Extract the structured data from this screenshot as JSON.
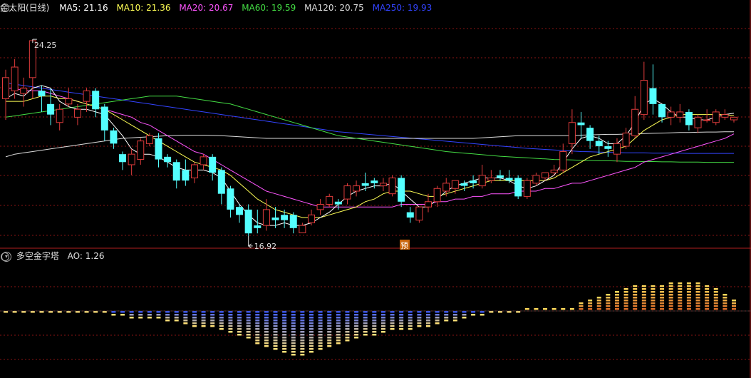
{
  "colors": {
    "background": "#000000",
    "grid": "#8a1515",
    "up_candle": "#e03c3c",
    "down_candle": "#54ffff",
    "ma5": "#ffffff",
    "ma10": "#ffff55",
    "ma20": "#ff55ff",
    "ma60": "#44dd44",
    "ma120": "#dddddd",
    "ma250": "#3344ff",
    "text": "#e0e0e0"
  },
  "main_header": {
    "collapse_icon": "circle-chevron-icon",
    "title": "金太阳(日线)",
    "ma5": "MA5: 21.16",
    "ma10": "MA10: 21.36",
    "ma20": "MA20: 20.67",
    "ma60": "MA60: 19.59",
    "ma120": "MA120: 20.75",
    "ma250": "MA250: 19.93"
  },
  "indicator_header": {
    "collapse_icon": "circle-chevron-icon",
    "title": "多空金字塔",
    "ao": "AO: 1.26"
  },
  "high_label": "24.25",
  "low_label": "16.92",
  "forecast_badge": "预",
  "chart_data": [
    {
      "type": "candlestick",
      "ylim": [
        16.5,
        25.2
      ],
      "candles": [
        [
          22.0,
          22.8,
          21.2,
          23.1
        ],
        [
          22.3,
          23.2,
          22.0,
          23.5
        ],
        [
          22.2,
          22.4,
          21.7,
          22.8
        ],
        [
          22.8,
          24.2,
          22.0,
          24.25
        ],
        [
          22.3,
          22.1,
          21.5,
          22.5
        ],
        [
          21.8,
          21.4,
          21.0,
          22.4
        ],
        [
          21.1,
          21.6,
          20.8,
          21.8
        ],
        [
          21.8,
          22.0,
          21.7,
          22.4
        ],
        [
          21.3,
          21.6,
          21.0,
          21.8
        ],
        [
          21.9,
          22.3,
          21.5,
          22.4
        ],
        [
          22.3,
          21.6,
          21.3,
          22.4
        ],
        [
          21.7,
          20.8,
          20.4,
          21.8
        ],
        [
          20.8,
          20.3,
          20.1,
          20.9
        ],
        [
          19.9,
          19.6,
          19.3,
          20.0
        ],
        [
          19.5,
          19.9,
          19.1,
          20.1
        ],
        [
          19.7,
          20.4,
          19.5,
          20.5
        ],
        [
          20.3,
          20.6,
          20.2,
          20.7
        ],
        [
          20.5,
          19.7,
          19.4,
          20.7
        ],
        [
          19.8,
          19.6,
          19.4,
          19.9
        ],
        [
          19.6,
          18.9,
          18.6,
          19.7
        ],
        [
          19.3,
          18.9,
          18.7,
          19.7
        ],
        [
          19.0,
          19.5,
          18.8,
          19.6
        ],
        [
          19.5,
          19.8,
          19.3,
          19.9
        ],
        [
          19.8,
          19.2,
          18.9,
          19.9
        ],
        [
          19.3,
          18.4,
          18.0,
          19.4
        ],
        [
          18.6,
          17.8,
          17.5,
          18.7
        ],
        [
          17.9,
          17.6,
          17.3,
          18.0
        ],
        [
          17.8,
          16.9,
          16.8,
          18.0
        ],
        [
          17.2,
          17.1,
          16.9,
          17.8
        ],
        [
          17.2,
          17.8,
          17.0,
          18.2
        ],
        [
          17.5,
          17.4,
          17.1,
          17.9
        ],
        [
          17.6,
          17.4,
          17.1,
          17.8
        ],
        [
          17.6,
          17.1,
          16.9,
          17.7
        ],
        [
          16.92,
          17.2,
          16.92,
          17.3
        ],
        [
          17.3,
          17.6,
          17.2,
          17.8
        ],
        [
          17.8,
          18.0,
          17.6,
          18.2
        ],
        [
          18.0,
          18.3,
          17.9,
          18.4
        ],
        [
          18.1,
          18.0,
          17.8,
          18.2
        ],
        [
          18.2,
          18.7,
          18.0,
          18.8
        ],
        [
          18.5,
          18.7,
          18.3,
          18.9
        ],
        [
          18.8,
          18.7,
          18.5,
          19.2
        ],
        [
          18.9,
          18.8,
          18.6,
          19.0
        ],
        [
          18.7,
          18.8,
          18.5,
          19.0
        ],
        [
          18.4,
          19.0,
          18.3,
          19.1
        ],
        [
          19.0,
          18.1,
          17.9,
          19.1
        ],
        [
          17.7,
          17.5,
          17.3,
          17.9
        ],
        [
          17.4,
          17.9,
          17.3,
          17.9
        ],
        [
          17.9,
          18.1,
          17.7,
          18.4
        ],
        [
          18.1,
          18.6,
          17.9,
          18.7
        ],
        [
          18.5,
          18.8,
          18.3,
          19.0
        ],
        [
          18.6,
          18.9,
          18.4,
          18.9
        ],
        [
          18.8,
          18.7,
          18.5,
          18.9
        ],
        [
          18.9,
          18.8,
          18.6,
          19.1
        ],
        [
          18.7,
          19.1,
          18.6,
          19.5
        ],
        [
          18.9,
          19.0,
          18.8,
          19.3
        ],
        [
          19.1,
          19.0,
          18.9,
          19.3
        ],
        [
          19.0,
          18.9,
          18.8,
          19.3
        ],
        [
          19.0,
          18.3,
          18.2,
          19.1
        ],
        [
          18.3,
          18.9,
          18.2,
          19.0
        ],
        [
          18.8,
          19.1,
          18.7,
          19.2
        ],
        [
          19.0,
          19.2,
          18.9,
          19.2
        ],
        [
          19.2,
          19.3,
          19.1,
          19.5
        ],
        [
          19.3,
          20.0,
          19.2,
          20.3
        ],
        [
          20.3,
          21.1,
          19.9,
          21.6
        ],
        [
          21.1,
          21.0,
          20.5,
          21.5
        ],
        [
          20.9,
          20.4,
          20.1,
          21.0
        ],
        [
          20.4,
          20.2,
          19.9,
          20.6
        ],
        [
          20.2,
          20.1,
          19.8,
          20.4
        ],
        [
          19.9,
          20.3,
          19.6,
          20.5
        ],
        [
          20.2,
          20.7,
          20.1,
          20.9
        ],
        [
          20.6,
          21.6,
          20.5,
          22.1
        ],
        [
          21.4,
          22.7,
          21.2,
          23.4
        ],
        [
          22.4,
          21.8,
          21.4,
          23.3
        ],
        [
          21.8,
          21.3,
          21.1,
          21.6
        ],
        [
          21.3,
          21.5,
          21.0,
          21.7
        ],
        [
          21.3,
          21.5,
          21.1,
          21.8
        ],
        [
          21.5,
          21.0,
          20.8,
          21.6
        ],
        [
          20.9,
          21.3,
          20.7,
          21.4
        ],
        [
          21.2,
          21.2,
          21.1,
          21.6
        ],
        [
          21.1,
          21.5,
          21.0,
          21.6
        ],
        [
          21.3,
          21.4,
          21.2,
          21.6
        ],
        [
          21.2,
          21.3,
          21.1,
          21.3
        ]
      ],
      "ma5": [
        22.0,
        22.2,
        22.1,
        22.4,
        22.5,
        22.4,
        21.9,
        21.7,
        21.6,
        21.6,
        21.5,
        21.4,
        21.0,
        20.6,
        20.1,
        19.9,
        19.9,
        19.8,
        19.6,
        19.4,
        19.3,
        19.3,
        19.3,
        19.2,
        19.0,
        18.5,
        18.0,
        17.6,
        17.3,
        17.2,
        17.2,
        17.3,
        17.2,
        17.2,
        17.3,
        17.5,
        17.7,
        18.0,
        18.3,
        18.5,
        18.6,
        18.7,
        18.7,
        18.8,
        18.5,
        18.2,
        17.9,
        17.9,
        18.2,
        18.5,
        18.7,
        18.8,
        18.9,
        19.0,
        19.0,
        19.0,
        18.9,
        18.7,
        18.6,
        18.7,
        18.9,
        19.1,
        19.6,
        20.1,
        20.5,
        20.6,
        20.5,
        20.3,
        20.3,
        20.6,
        21.1,
        21.8,
        22.0,
        21.8,
        21.5,
        21.3,
        21.3,
        21.2,
        21.2,
        21.3,
        21.4,
        21.45
      ],
      "ma10": [
        21.9,
        21.9,
        21.9,
        22.0,
        22.1,
        22.1,
        22.0,
        22.0,
        21.9,
        21.8,
        21.7,
        21.6,
        21.4,
        21.2,
        21.0,
        20.8,
        20.6,
        20.4,
        20.2,
        20.0,
        19.8,
        19.6,
        19.5,
        19.4,
        19.3,
        19.1,
        18.8,
        18.5,
        18.2,
        18.0,
        17.8,
        17.7,
        17.6,
        17.5,
        17.5,
        17.5,
        17.6,
        17.7,
        17.8,
        17.9,
        18.1,
        18.2,
        18.4,
        18.5,
        18.5,
        18.5,
        18.4,
        18.3,
        18.3,
        18.4,
        18.5,
        18.6,
        18.7,
        18.8,
        18.9,
        18.9,
        18.9,
        18.9,
        18.9,
        18.9,
        18.9,
        19.0,
        19.2,
        19.4,
        19.6,
        19.8,
        19.9,
        20.0,
        20.1,
        20.2,
        20.5,
        20.8,
        21.0,
        21.2,
        21.3,
        21.4,
        21.4,
        21.4,
        21.4,
        21.4,
        21.4,
        21.36
      ],
      "ma20": [
        22.4,
        22.4,
        22.3,
        22.3,
        22.3,
        22.2,
        22.1,
        22.0,
        21.9,
        21.8,
        21.7,
        21.6,
        21.5,
        21.4,
        21.3,
        21.1,
        21.0,
        20.8,
        20.6,
        20.4,
        20.2,
        20.0,
        19.9,
        19.7,
        19.5,
        19.3,
        19.1,
        18.9,
        18.7,
        18.5,
        18.4,
        18.3,
        18.2,
        18.1,
        18.0,
        17.9,
        17.9,
        17.9,
        17.9,
        17.9,
        17.9,
        17.9,
        17.9,
        17.9,
        18.0,
        18.0,
        18.0,
        18.0,
        18.1,
        18.1,
        18.2,
        18.2,
        18.3,
        18.3,
        18.4,
        18.4,
        18.4,
        18.5,
        18.5,
        18.5,
        18.6,
        18.6,
        18.7,
        18.8,
        18.8,
        18.9,
        19.0,
        19.1,
        19.2,
        19.3,
        19.4,
        19.6,
        19.7,
        19.8,
        19.9,
        20.0,
        20.1,
        20.2,
        20.3,
        20.4,
        20.5,
        20.67
      ],
      "ma60": [
        21.3,
        21.35,
        21.4,
        21.45,
        21.5,
        21.55,
        21.6,
        21.65,
        21.7,
        21.75,
        21.8,
        21.85,
        21.9,
        21.95,
        22.0,
        22.05,
        22.1,
        22.1,
        22.1,
        22.1,
        22.05,
        22.0,
        21.95,
        21.9,
        21.85,
        21.8,
        21.7,
        21.6,
        21.5,
        21.4,
        21.3,
        21.2,
        21.1,
        21.0,
        20.9,
        20.8,
        20.7,
        20.6,
        20.55,
        20.5,
        20.45,
        20.4,
        20.35,
        20.3,
        20.25,
        20.2,
        20.15,
        20.1,
        20.05,
        20.0,
        19.97,
        19.94,
        19.91,
        19.88,
        19.85,
        19.82,
        19.8,
        19.78,
        19.76,
        19.74,
        19.72,
        19.7,
        19.69,
        19.68,
        19.67,
        19.66,
        19.65,
        19.65,
        19.64,
        19.63,
        19.63,
        19.62,
        19.62,
        19.61,
        19.61,
        19.6,
        19.6,
        19.6,
        19.59,
        19.59,
        19.59,
        19.59
      ],
      "ma120": [
        19.8,
        19.9,
        19.95,
        20.0,
        20.05,
        20.1,
        20.15,
        20.2,
        20.25,
        20.3,
        20.35,
        20.4,
        20.45,
        20.5,
        20.52,
        20.54,
        20.56,
        20.58,
        20.6,
        20.61,
        20.62,
        20.62,
        20.62,
        20.61,
        20.6,
        20.58,
        20.56,
        20.54,
        20.52,
        20.5,
        20.5,
        20.5,
        20.5,
        20.5,
        20.5,
        20.5,
        20.5,
        20.5,
        20.5,
        20.5,
        20.5,
        20.5,
        20.5,
        20.5,
        20.5,
        20.5,
        20.5,
        20.5,
        20.5,
        20.5,
        20.5,
        20.5,
        20.5,
        20.52,
        20.54,
        20.56,
        20.58,
        20.6,
        20.6,
        20.6,
        20.6,
        20.6,
        20.6,
        20.6,
        20.62,
        20.63,
        20.64,
        20.65,
        20.65,
        20.66,
        20.67,
        20.68,
        20.69,
        20.7,
        20.71,
        20.72,
        20.72,
        20.73,
        20.74,
        20.74,
        20.75,
        20.75
      ],
      "ma250": [
        22.6,
        22.55,
        22.5,
        22.45,
        22.4,
        22.35,
        22.3,
        22.25,
        22.2,
        22.15,
        22.1,
        22.05,
        22.0,
        21.95,
        21.9,
        21.85,
        21.8,
        21.75,
        21.7,
        21.65,
        21.6,
        21.55,
        21.5,
        21.45,
        21.4,
        21.35,
        21.3,
        21.25,
        21.2,
        21.15,
        21.1,
        21.05,
        21.0,
        20.95,
        20.9,
        20.85,
        20.8,
        20.75,
        20.72,
        20.69,
        20.66,
        20.63,
        20.6,
        20.57,
        20.54,
        20.51,
        20.48,
        20.45,
        20.42,
        20.39,
        20.36,
        20.33,
        20.3,
        20.27,
        20.24,
        20.21,
        20.18,
        20.15,
        20.12,
        20.1,
        20.08,
        20.06,
        20.04,
        20.02,
        20.0,
        19.99,
        19.98,
        19.97,
        19.96,
        19.95,
        19.95,
        19.95,
        19.94,
        19.94,
        19.94,
        19.94,
        19.93,
        19.93,
        19.93,
        19.93,
        19.93,
        19.93
      ]
    },
    {
      "type": "bar",
      "name": "多空金字塔",
      "ylim": [
        -6.0,
        4.5
      ],
      "values": [
        -0.05,
        -0.1,
        -0.2,
        -0.3,
        -0.3,
        -0.25,
        -0.2,
        -0.2,
        -0.25,
        -0.3,
        -0.4,
        -0.5,
        -0.7,
        -0.9,
        -1.0,
        -1.1,
        -1.1,
        -1.2,
        -1.3,
        -1.5,
        -1.7,
        -1.9,
        -2.0,
        -2.1,
        -2.3,
        -2.6,
        -3.0,
        -3.4,
        -3.8,
        -4.2,
        -4.5,
        -4.8,
        -5.0,
        -5.1,
        -4.9,
        -4.6,
        -4.3,
        -4.0,
        -3.7,
        -3.4,
        -3.1,
        -2.8,
        -2.6,
        -2.4,
        -2.3,
        -2.2,
        -2.1,
        -1.9,
        -1.7,
        -1.5,
        -1.3,
        -1.1,
        -0.9,
        -0.7,
        -0.5,
        -0.3,
        -0.2,
        -0.1,
        0.0,
        0.1,
        0.05,
        0.0,
        0.2,
        0.6,
        1.0,
        1.4,
        1.8,
        2.1,
        2.4,
        2.6,
        2.8,
        2.9,
        3.0,
        3.1,
        3.2,
        3.25,
        3.3,
        3.2,
        3.1,
        2.6,
        2.0,
        1.26
      ]
    }
  ]
}
